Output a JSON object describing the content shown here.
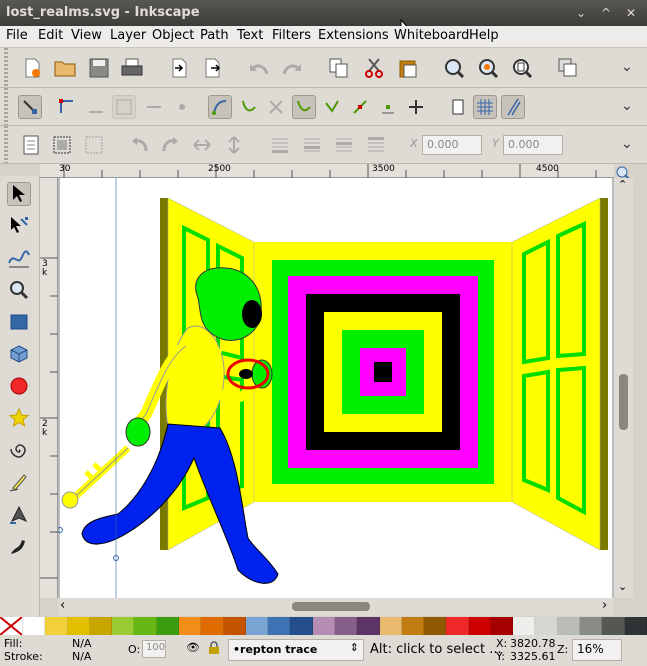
{
  "window": {
    "title": "lost_realms.svg - Inkscape",
    "minimize_glyph": "⌄",
    "restore_glyph": "^",
    "close_glyph": "✕"
  },
  "menu": [
    "File",
    "Edit",
    "View",
    "Layer",
    "Object",
    "Path",
    "Text",
    "Filters",
    "Extensions",
    "Whiteboard",
    "Help"
  ],
  "tool_controls": {
    "x_value": "0.000",
    "y_value": "0.000",
    "x_label": "X",
    "y_label": "Y"
  },
  "rulers": {
    "h_labels": [
      "30",
      "2500",
      "3500",
      "4500"
    ],
    "v_labels": [
      "3k",
      "2k"
    ]
  },
  "status": {
    "fill_label": "Fill:",
    "fill_value": "N/A",
    "stroke_label": "Stroke:",
    "stroke_value": "N/A",
    "opacity_label": "O:",
    "opacity_value": "100",
    "layer": "•repton trace",
    "message": "Alt: click to select ...",
    "x_label": "X:",
    "x_value": "3820.78",
    "y_label": "Y:",
    "y_value": "3325.61",
    "zoom_label": "Z:",
    "zoom_value": "16%"
  },
  "palette": [
    "#ffffff",
    "#f2d03a",
    "#e2c000",
    "#c8a600",
    "#99cc33",
    "#66b714",
    "#3b9e10",
    "#f28e18",
    "#e06c00",
    "#c45300",
    "#7aa4d4",
    "#3d73b5",
    "#244f8a",
    "#b58cb2",
    "#855f8a",
    "#5c3566",
    "#e9b96e",
    "#c17d11",
    "#8f5902",
    "#ef2929",
    "#cc0000",
    "#a40000",
    "#eeeeec",
    "#d3d7cf",
    "#babdb6",
    "#888a85",
    "#555753",
    "#2e3436"
  ],
  "icons": {
    "selector": "arrow-tool-icon",
    "node": "node-tool-icon",
    "zoom": "magnifier-icon"
  }
}
